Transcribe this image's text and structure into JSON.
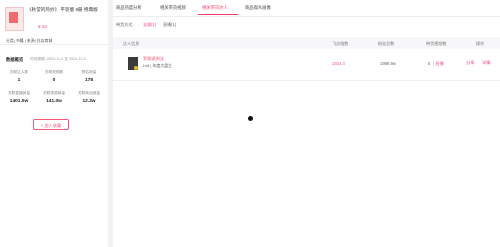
{
  "product": {
    "title": "《秋莹的热抄》 平装版 8册 特典版",
    "price": "¥ 22",
    "meta": "分类| 书籍 | 来源| 抖店商城"
  },
  "data_overview": {
    "title": "数据概览",
    "time": "时间周期: 2024-11-3 至 2024-12-2",
    "stats": [
      {
        "label": "关联达人数",
        "value": "1"
      },
      {
        "label": "关联视频数",
        "value": "0"
      },
      {
        "label": "预估销量",
        "value": "178"
      },
      {
        "label": "关联直播销量",
        "value": "1401.0w"
      },
      {
        "label": "关联视频销量",
        "value": "141.0w"
      },
      {
        "label": "关联商品销量",
        "value": "12.3w"
      }
    ],
    "collect_button": "+ 加入收藏"
  },
  "tabs": [
    {
      "label": "商品热度分析",
      "active": false
    },
    {
      "label": "相关带货视频",
      "active": false
    },
    {
      "label": "相关带货达人",
      "active": true
    },
    {
      "label": "商品观众画像",
      "active": false
    }
  ],
  "filter": {
    "label": "带货方式:",
    "options": [
      {
        "label": "全部(1)",
        "active": true
      },
      {
        "label": "直播(1)",
        "active": false
      }
    ]
  },
  "table": {
    "headers": [
      "达人信息",
      "飞瓜指数",
      "粉丝总数",
      "带货视频数",
      "操作"
    ],
    "rows": [
      {
        "name": "罗翔说刑法",
        "subtitle": "Lv6 | 年度大盘主",
        "score": "1502.4",
        "fans": "1999.9w",
        "videos": "0",
        "videos_extra": "| 直播",
        "actions": [
          "分享",
          "详情"
        ]
      }
    ]
  },
  "colors": {
    "accent": "#f23d6b",
    "background": "#f1f2f5"
  }
}
